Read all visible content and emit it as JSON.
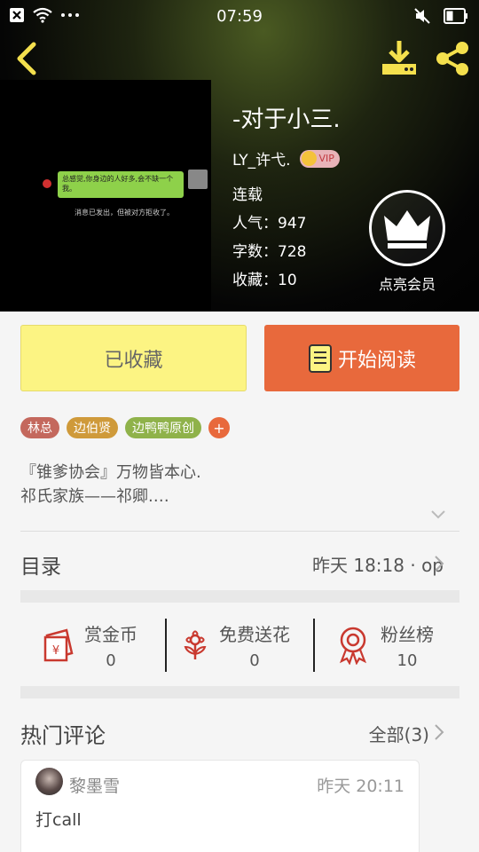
{
  "status_bar": {
    "time": "07:59"
  },
  "book": {
    "title": "-对于小三.",
    "author": "LY_许弋.",
    "vip_label": "VIP",
    "status": "连载",
    "popularity": "人气：947",
    "word_count": "字数：728",
    "favorites": "收藏：10"
  },
  "cover": {
    "chat_message": "总感觉,你身边的人好多,会不缺一个我。",
    "chat_note": "消息已发出，但被对方拒收了。"
  },
  "member": {
    "label": "点亮会员"
  },
  "actions": {
    "collected_label": "已收藏",
    "read_label": "开始阅读"
  },
  "tags": [
    {
      "label": "林总",
      "color": "#c4685d"
    },
    {
      "label": "边伯贤",
      "color": "#cf9a3a"
    },
    {
      "label": "边鸭鸭原创",
      "color": "#8fb24a"
    }
  ],
  "tag_add": "+",
  "intro": {
    "line1": "『锥爹协会』万物皆本心.",
    "line2": "祁氏家族——祁卿.…"
  },
  "toc": {
    "title": "目录",
    "info": "昨天 18:18 · op"
  },
  "rewards": [
    {
      "label": "赏金币",
      "value": "0",
      "icon": "red-envelope-icon"
    },
    {
      "label": "免费送花",
      "value": "0",
      "icon": "flower-icon"
    },
    {
      "label": "粉丝榜",
      "value": "10",
      "icon": "medal-icon"
    }
  ],
  "comments": {
    "title": "热门评论",
    "all_label": "全部(3)",
    "items": [
      {
        "user": "黎墨雪",
        "time": "昨天 20:11",
        "text": "打call"
      }
    ]
  },
  "colors": {
    "accent": "#e8693c",
    "collected_bg": "#fcf483",
    "icon_red": "#c9392f",
    "header_icon": "#f4e04d"
  }
}
